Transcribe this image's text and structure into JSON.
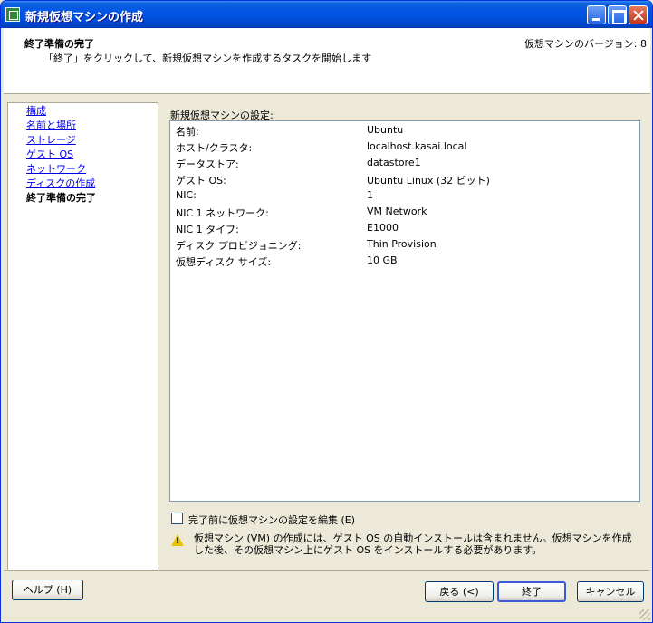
{
  "window": {
    "title": "新規仮想マシンの作成"
  },
  "header": {
    "title": "終了準備の完了",
    "subtitle": "「終了」をクリックして、新規仮想マシンを作成するタスクを開始します",
    "version": "仮想マシンのバージョン: 8"
  },
  "nav": {
    "items": [
      {
        "label": "構成",
        "state": "link"
      },
      {
        "label": "名前と場所",
        "state": "link"
      },
      {
        "label": "ストレージ",
        "state": "link"
      },
      {
        "label": "ゲスト OS",
        "state": "link"
      },
      {
        "label": "ネットワーク",
        "state": "link"
      },
      {
        "label": "ディスクの作成",
        "state": "link"
      },
      {
        "label": "終了準備の完了",
        "state": "current"
      }
    ]
  },
  "settings": {
    "label": "新規仮想マシンの設定:",
    "rows": [
      {
        "key": "名前:",
        "value": "Ubuntu"
      },
      {
        "key": "ホスト/クラスタ:",
        "value": "localhost.kasai.local"
      },
      {
        "key": "データストア:",
        "value": "datastore1"
      },
      {
        "key": "ゲスト OS:",
        "value": "Ubuntu Linux (32 ビット)"
      },
      {
        "key": "NIC:",
        "value": "1"
      },
      {
        "key": "NIC 1 ネットワーク:",
        "value": "VM Network"
      },
      {
        "key": "NIC 1 タイプ:",
        "value": "E1000"
      },
      {
        "key": "ディスク プロビジョニング:",
        "value": "Thin Provision"
      },
      {
        "key": "仮想ディスク サイズ:",
        "value": "10 GB"
      }
    ]
  },
  "edit_checkbox": {
    "label": "完了前に仮想マシンの設定を編集 (E)",
    "checked": false
  },
  "warning": {
    "text": "仮想マシン (VM) の作成には、ゲスト OS の自動インストールは含まれません。仮想マシンを作成した後、その仮想マシン上にゲスト OS をインストールする必要があります。"
  },
  "buttons": {
    "help": "ヘルプ (H)",
    "back": "戻る (<)",
    "finish": "終了",
    "cancel": "キャンセル"
  }
}
